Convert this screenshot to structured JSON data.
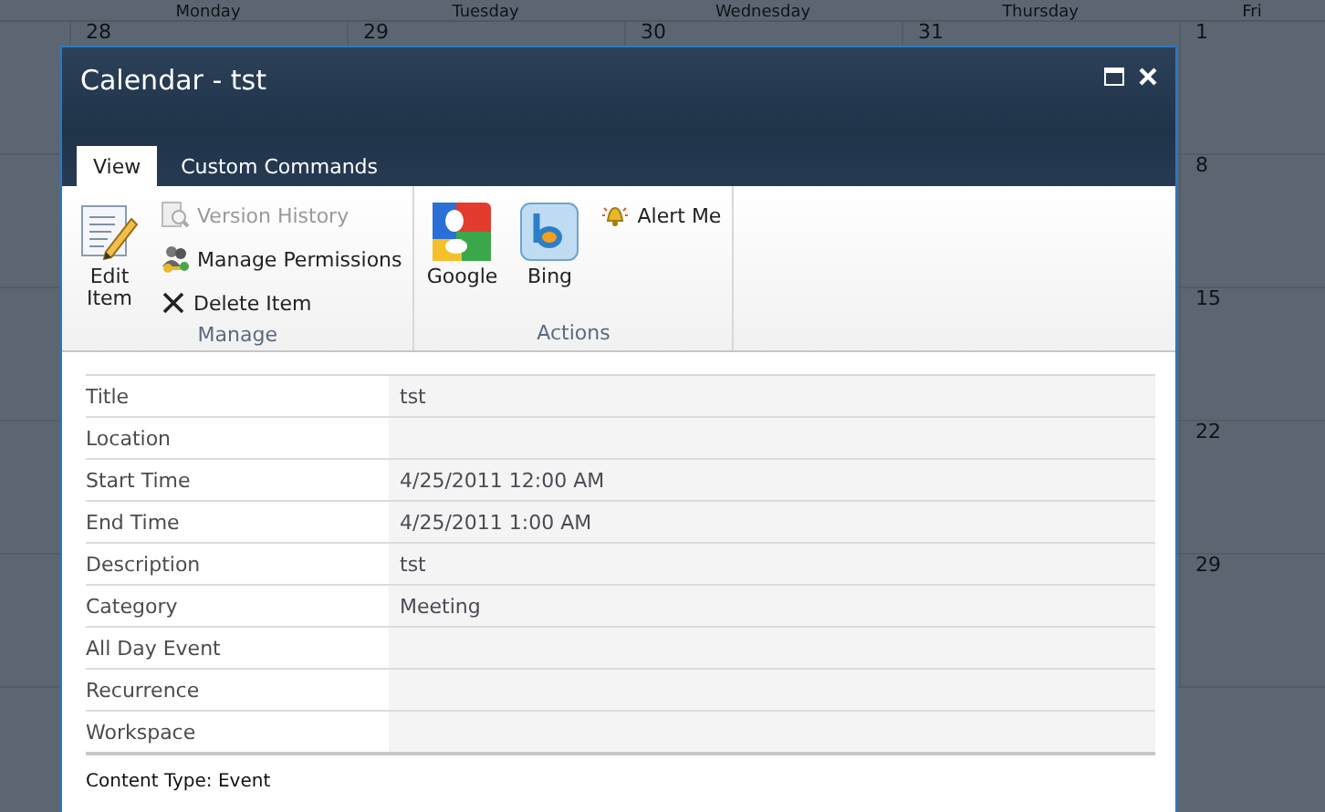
{
  "calendar": {
    "day_headers": [
      "Monday",
      "Tuesday",
      "Wednesday",
      "Thursday",
      "Fri"
    ],
    "first_week_dates": [
      "28",
      "29",
      "30",
      "31",
      "1"
    ],
    "right_column_dates": [
      "8",
      "15",
      "22",
      "29"
    ]
  },
  "dialog": {
    "title": "Calendar - tst",
    "tabs": [
      {
        "label": "View",
        "selected": true
      },
      {
        "label": "Custom Commands",
        "selected": false
      }
    ],
    "ribbon_groups": [
      {
        "label": "Manage",
        "items": [
          {
            "label": "Edit Item",
            "kind": "large",
            "disabled": false
          },
          {
            "label": "Version History",
            "kind": "small",
            "disabled": true
          },
          {
            "label": "Manage Permissions",
            "kind": "small",
            "disabled": false
          },
          {
            "label": "Delete Item",
            "kind": "small",
            "disabled": false
          }
        ]
      },
      {
        "label": "Actions",
        "items": [
          {
            "label": "Google",
            "kind": "large",
            "disabled": false
          },
          {
            "label": "Bing",
            "kind": "large",
            "disabled": false
          },
          {
            "label": "Alert Me",
            "kind": "small",
            "disabled": false
          }
        ]
      }
    ],
    "fields": [
      {
        "label": "Title",
        "value": "tst"
      },
      {
        "label": "Location"
      },
      {
        "label": "Start Time",
        "value": "4/25/2011 12:00 AM"
      },
      {
        "label": "End Time",
        "value": "4/25/2011 1:00 AM"
      },
      {
        "label": "Description",
        "value": "tst"
      },
      {
        "label": "Category",
        "value": "Meeting"
      },
      {
        "label": "All Day Event"
      },
      {
        "label": "Recurrence"
      },
      {
        "label": "Workspace"
      }
    ],
    "content_type": "Content Type: Event"
  }
}
